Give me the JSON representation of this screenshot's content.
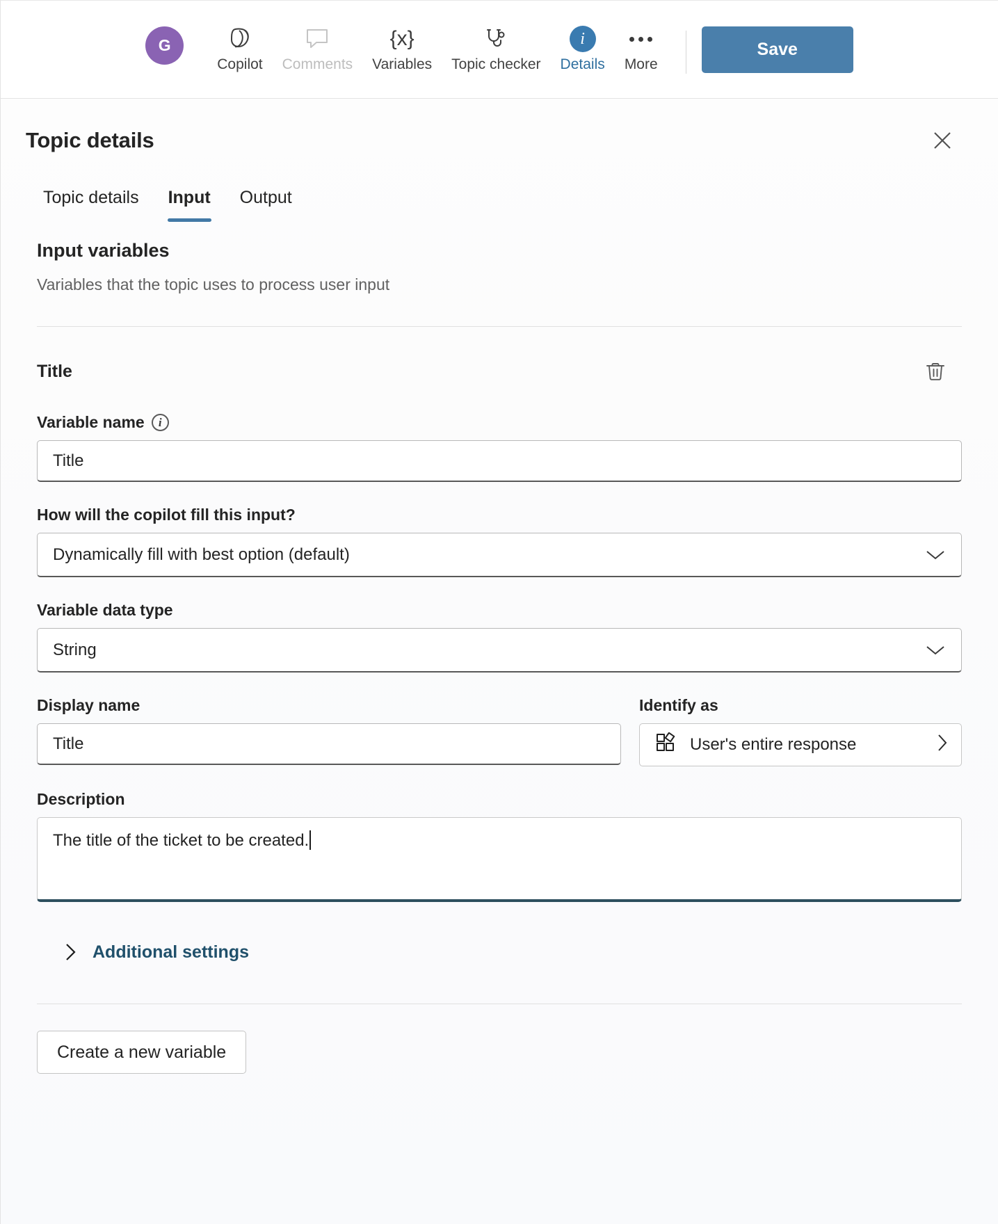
{
  "commandbar": {
    "avatar_initial": "G",
    "items": [
      {
        "label": "Copilot",
        "icon": "copilot-icon",
        "state": "normal"
      },
      {
        "label": "Comments",
        "icon": "comment-icon",
        "state": "disabled"
      },
      {
        "label": "Variables",
        "icon": "variables-braces-icon",
        "state": "normal"
      },
      {
        "label": "Topic checker",
        "icon": "stethoscope-icon",
        "state": "normal"
      },
      {
        "label": "Details",
        "icon": "info-circle-icon",
        "state": "active"
      },
      {
        "label": "More",
        "icon": "ellipsis-icon",
        "state": "normal"
      }
    ],
    "save_label": "Save",
    "accent_color": "#4a7fab",
    "avatar_color": "#8a63b3",
    "active_color": "#2f6f9f"
  },
  "panel": {
    "title": "Topic details",
    "close_icon": "close-icon",
    "tabs": [
      {
        "label": "Topic details",
        "selected": false
      },
      {
        "label": "Input",
        "selected": true
      },
      {
        "label": "Output",
        "selected": false
      }
    ],
    "section": {
      "title": "Input variables",
      "subtitle": "Variables that the topic uses to process user input"
    },
    "variable": {
      "name": "Title",
      "delete_icon": "trash-icon",
      "variable_name_label": "Variable name",
      "variable_name_info_icon": "info-icon",
      "variable_name_value": "Title",
      "fill_label": "How will the copilot fill this input?",
      "fill_value": "Dynamically fill with best option (default)",
      "data_type_label": "Variable data type",
      "data_type_value": "String",
      "display_name_label": "Display name",
      "display_name_value": "Title",
      "identify_as_label": "Identify as",
      "identify_as_value": "User's entire response",
      "identify_as_icon": "slots-icon",
      "description_label": "Description",
      "description_value": "The title of the ticket to be created.",
      "additional_settings_label": "Additional settings",
      "additional_settings_icon": "chevron-right-icon"
    },
    "create_variable_label": "Create a new variable"
  }
}
